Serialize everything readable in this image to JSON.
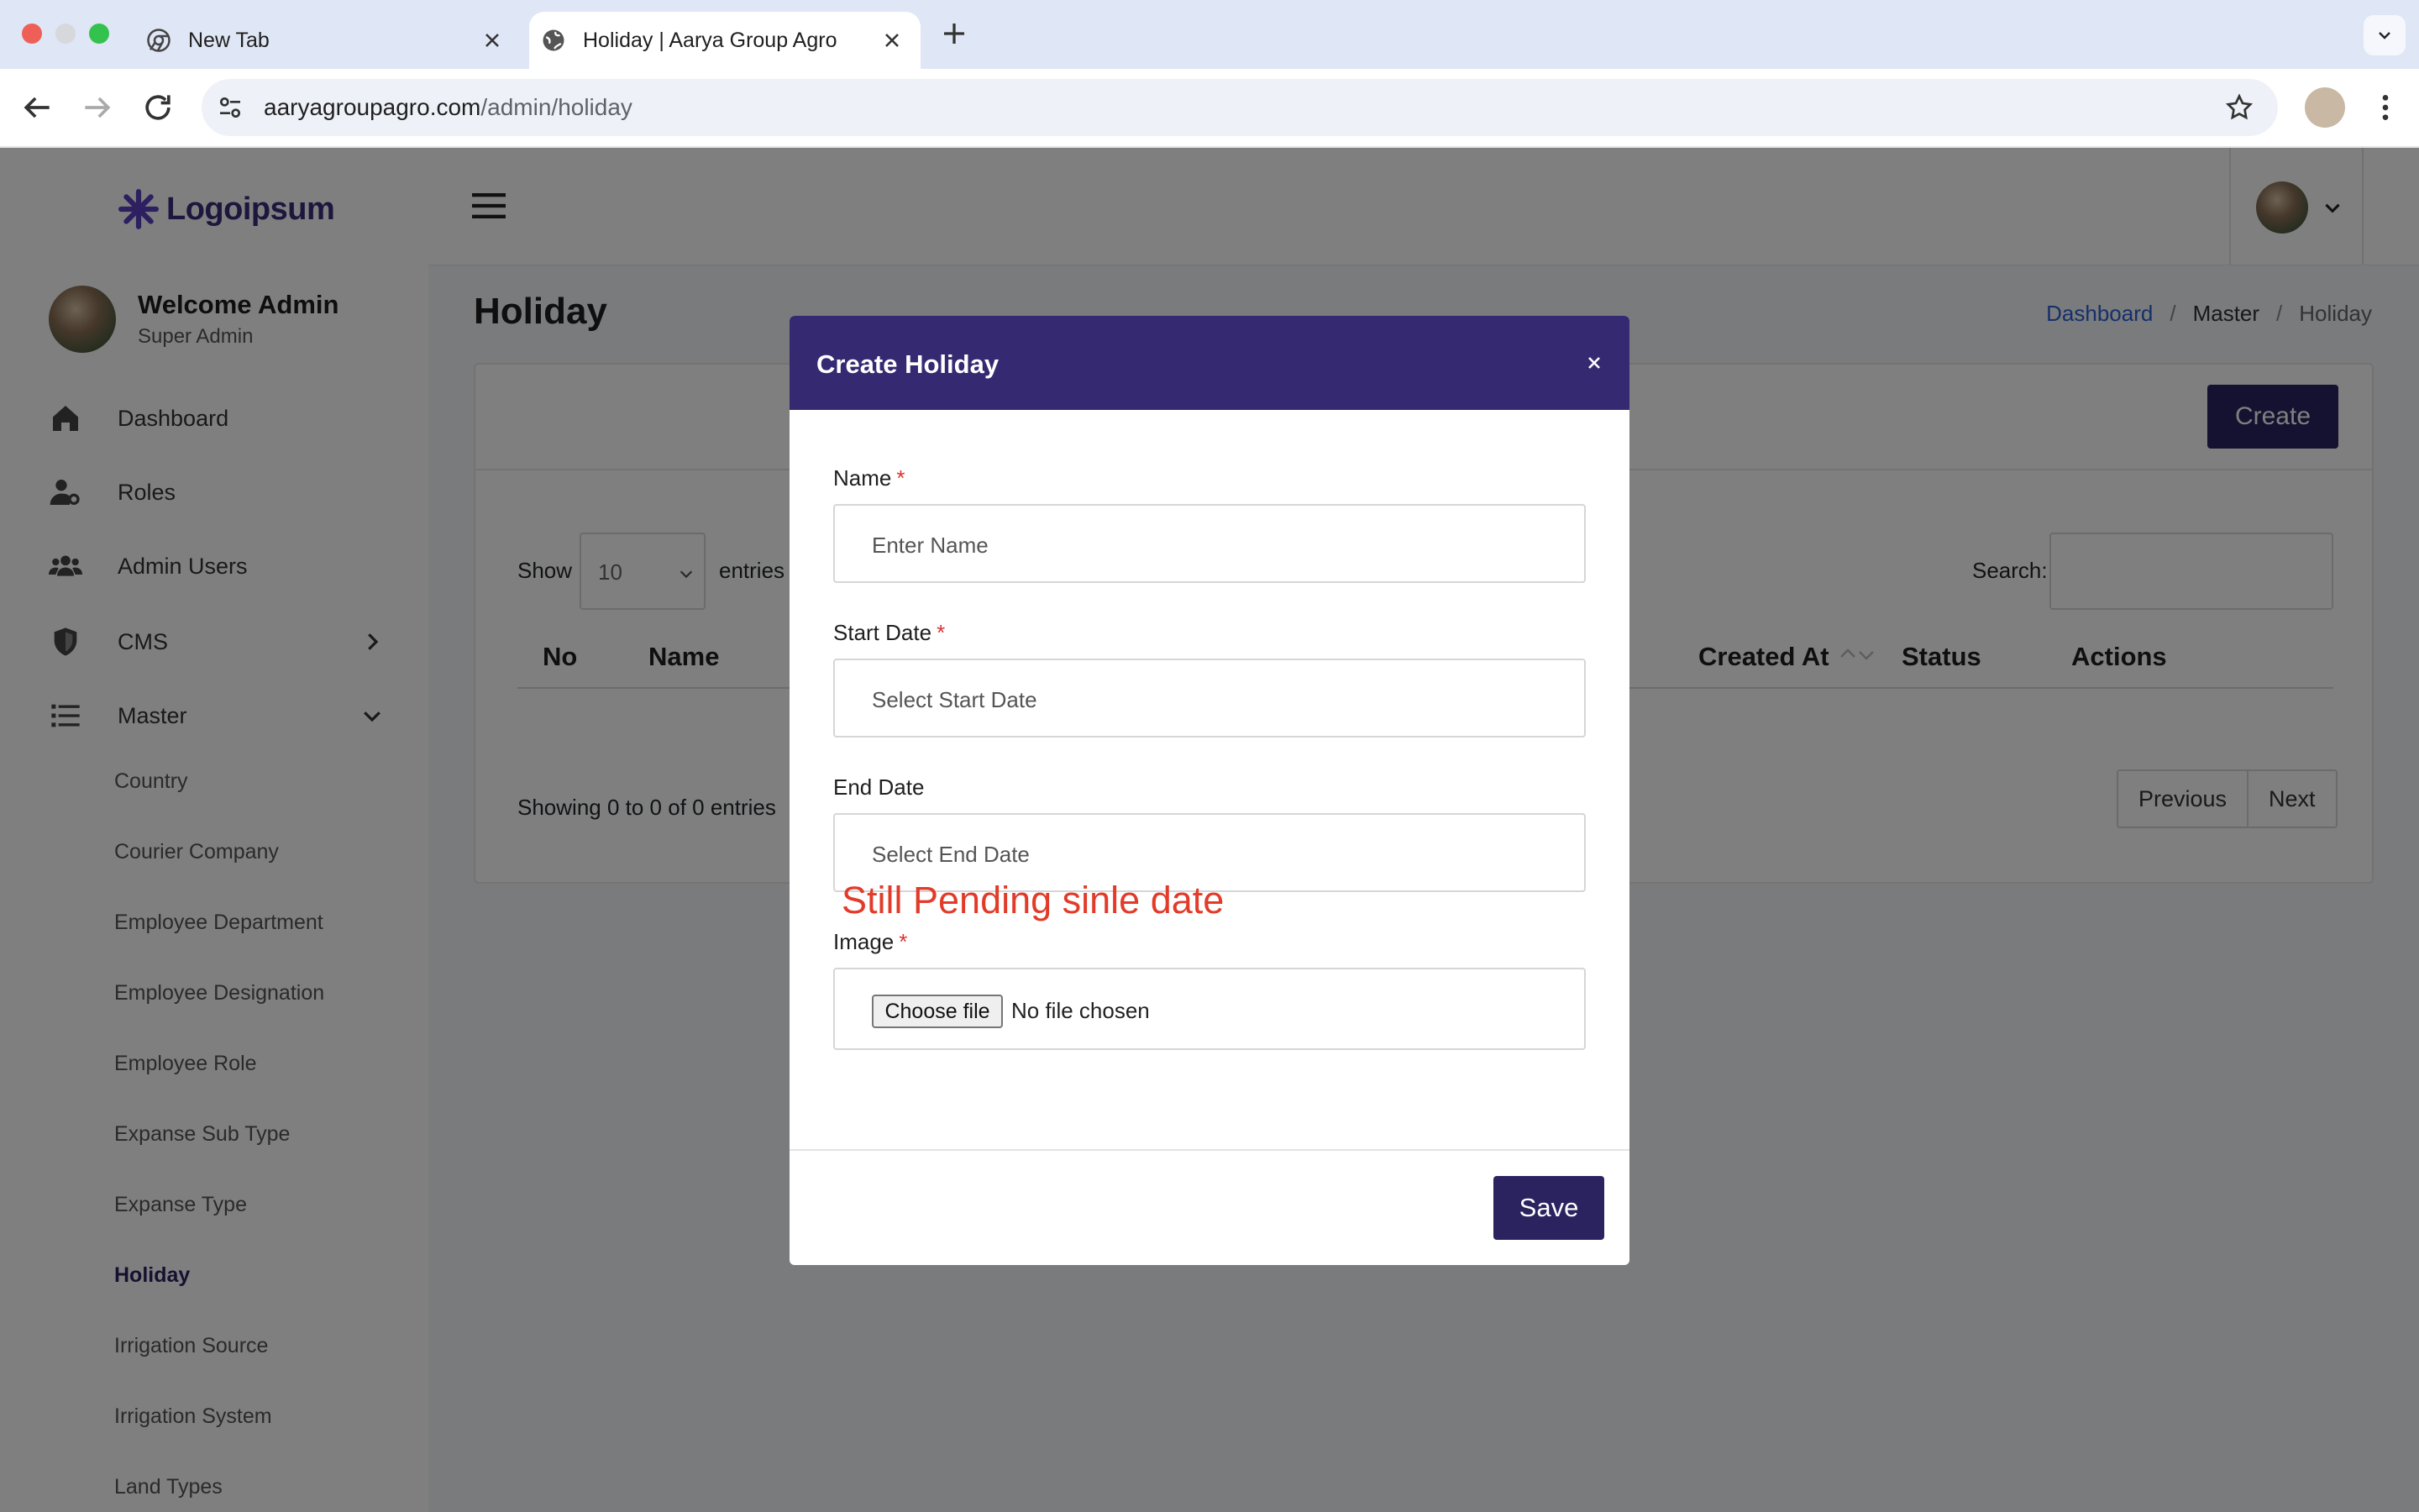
{
  "browser": {
    "tabs": [
      {
        "title": "New Tab"
      },
      {
        "title": "Holiday | Aarya Group Agro"
      }
    ],
    "url_host": "aaryagroupagro.com",
    "url_path": "/admin/holiday"
  },
  "sidebar": {
    "logo_text": "Logoipsum",
    "user_name": "Welcome Admin",
    "user_role": "Super Admin",
    "nav": [
      {
        "label": "Dashboard",
        "icon": "home-icon"
      },
      {
        "label": "Roles",
        "icon": "user-gear-icon"
      },
      {
        "label": "Admin Users",
        "icon": "users-icon"
      },
      {
        "label": "CMS",
        "icon": "shield-icon"
      },
      {
        "label": "Master",
        "icon": "list-icon"
      }
    ],
    "master_items": [
      "Country",
      "Courier Company",
      "Employee Department",
      "Employee Designation",
      "Employee Role",
      "Expanse Sub Type",
      "Expanse Type",
      "Holiday",
      "Irrigation Source",
      "Irrigation System",
      "Land Types"
    ]
  },
  "main": {
    "page_title": "Holiday",
    "breadcrumb": [
      "Dashboard",
      "Master",
      "Holiday"
    ],
    "create_label": "Create",
    "show_label": "Show",
    "page_size": "10",
    "entries_label": "entries",
    "search_label": "Search:",
    "columns": [
      "No",
      "Name",
      "Created At",
      "Status",
      "Actions"
    ],
    "showing_text": "Showing 0 to 0 of 0 entries",
    "pager": {
      "previous": "Previous",
      "next": "Next"
    }
  },
  "modal": {
    "title": "Create Holiday",
    "fields": {
      "name": {
        "label": "Name",
        "placeholder": "Enter Name"
      },
      "start_date": {
        "label": "Start Date",
        "placeholder": "Select Start Date"
      },
      "end_date": {
        "label": "End Date",
        "placeholder": "Select End Date"
      },
      "image": {
        "label": "Image",
        "button": "Choose file",
        "status": "No file chosen"
      }
    },
    "annotation": "Still Pending sinle date",
    "save_label": "Save"
  },
  "colors": {
    "brand": "#2b2360",
    "modal_header": "#352a72",
    "annotation": "#e23b2a",
    "link": "#2c5fd6"
  }
}
